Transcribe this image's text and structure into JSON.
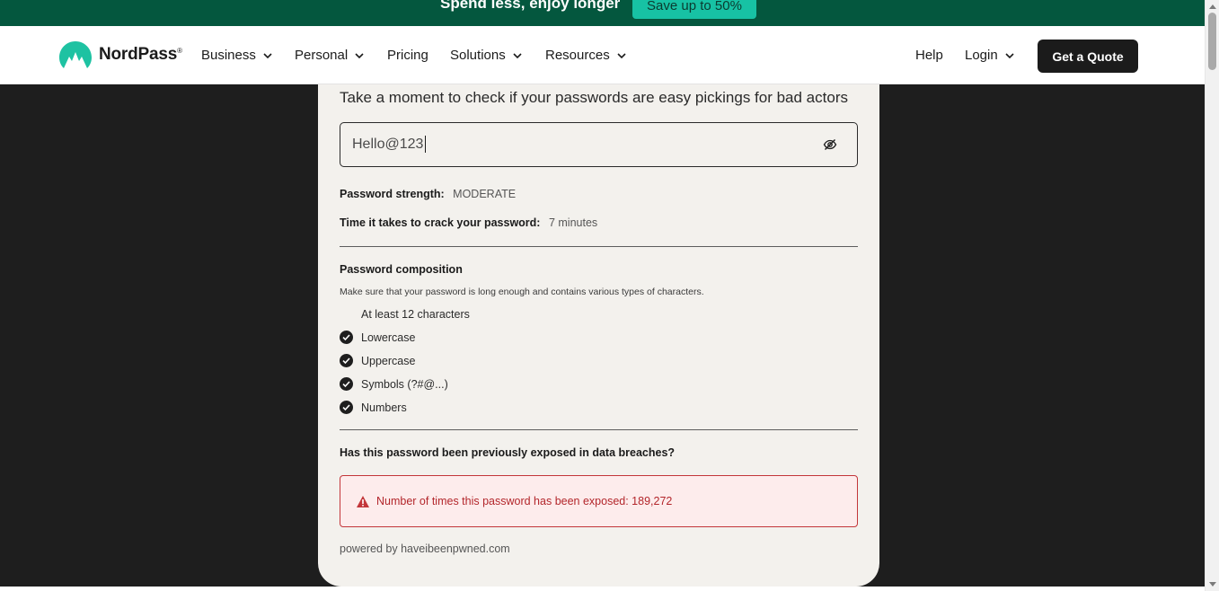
{
  "promo": {
    "text": "Spend less, enjoy longer",
    "button_label": "Save up to 50%"
  },
  "header": {
    "logo_text": "NordPass",
    "logo_mark": "®",
    "nav": [
      {
        "label": "Business",
        "has_dropdown": true
      },
      {
        "label": "Personal",
        "has_dropdown": true
      },
      {
        "label": "Pricing",
        "has_dropdown": false
      },
      {
        "label": "Solutions",
        "has_dropdown": true
      },
      {
        "label": "Resources",
        "has_dropdown": true
      }
    ],
    "help_label": "Help",
    "login_label": "Login",
    "cta_label": "Get a Quote"
  },
  "checker": {
    "intro": "Take a moment to check if your passwords are easy pickings for bad actors",
    "password_value": "Hello@123",
    "strength_label": "Password strength:",
    "strength_value": "MODERATE",
    "crack_label": "Time it takes to crack your password:",
    "crack_value": "7 minutes",
    "composition_title": "Password composition",
    "composition_hint": "Make sure that your password is long enough and contains various types of characters.",
    "requirements": [
      {
        "label": "At least 12 characters",
        "met": false
      },
      {
        "label": "Lowercase",
        "met": true
      },
      {
        "label": "Uppercase",
        "met": true
      },
      {
        "label": "Symbols (?#@...)",
        "met": true
      },
      {
        "label": "Numbers",
        "met": true
      }
    ],
    "breach_question": "Has this password been previously exposed in data breaches?",
    "breach_message": "Number of times this password has been exposed: 189,272",
    "powered_by": "powered by haveibeenpwned.com"
  },
  "colors": {
    "promo_bg": "#04573e",
    "promo_button": "#17c2a4",
    "brand_teal": "#1ec2a2",
    "card_bg": "#f3f1ed",
    "page_bg": "#1e1e1e",
    "breach_red": "#b3262b"
  },
  "icons": {
    "logo": "nordpass-mountain-icon",
    "password_toggle": "eye-slash-icon",
    "requirement_met": "check-circle-icon",
    "breach_alert": "warning-triangle-icon",
    "dropdown": "chevron-down-icon"
  }
}
